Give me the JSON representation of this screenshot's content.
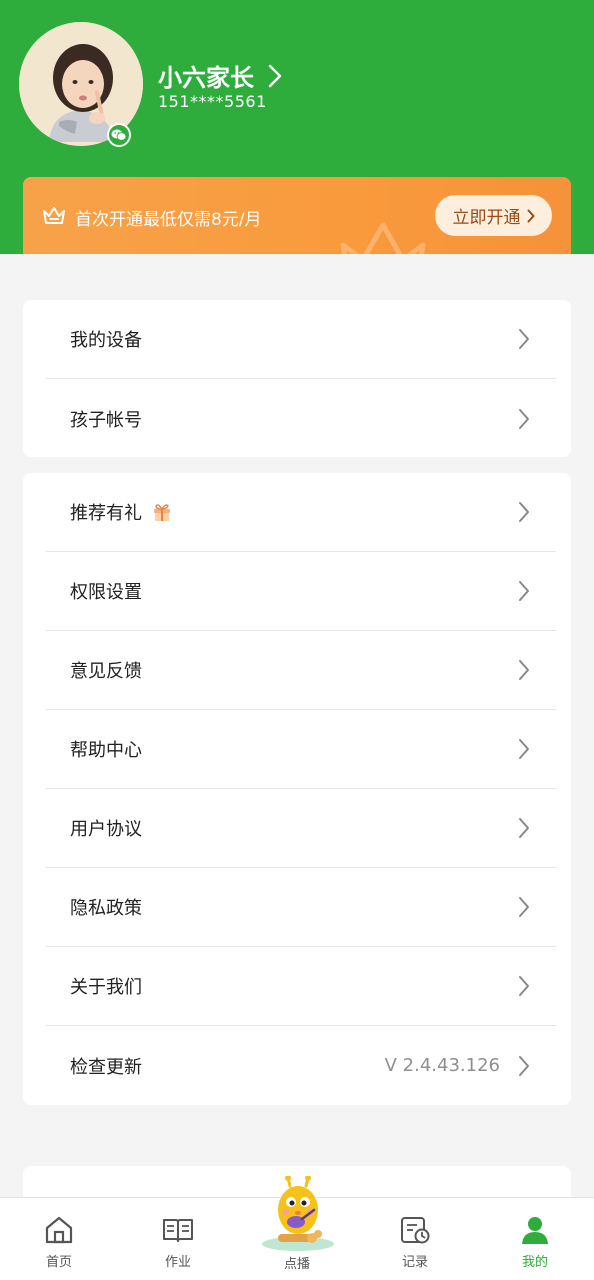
{
  "profile": {
    "name": "小六家长",
    "phone": "151****5561"
  },
  "vip": {
    "text": "首次开通最低仅需8元/月",
    "button_label": "立即开通"
  },
  "menu_group_1": [
    {
      "label": "我的设备"
    },
    {
      "label": "孩子帐号"
    }
  ],
  "menu_group_2": [
    {
      "label": "推荐有礼"
    },
    {
      "label": "权限设置"
    },
    {
      "label": "意见反馈"
    },
    {
      "label": "帮助中心"
    },
    {
      "label": "用户协议"
    },
    {
      "label": "隐私政策"
    },
    {
      "label": "关于我们"
    },
    {
      "label": "检查更新",
      "value": "V 2.4.43.126"
    }
  ],
  "bottom_nav": [
    {
      "label": "首页",
      "icon": "home-icon"
    },
    {
      "label": "作业",
      "icon": "book-icon"
    },
    {
      "label": "点播",
      "icon": "mascot-icon"
    },
    {
      "label": "记录",
      "icon": "record-icon"
    },
    {
      "label": "我的",
      "icon": "user-icon",
      "active": true
    }
  ],
  "colors": {
    "brand_green": "#2ead3d",
    "vip_orange": "#f99a3c",
    "background": "#f4f4f4"
  }
}
